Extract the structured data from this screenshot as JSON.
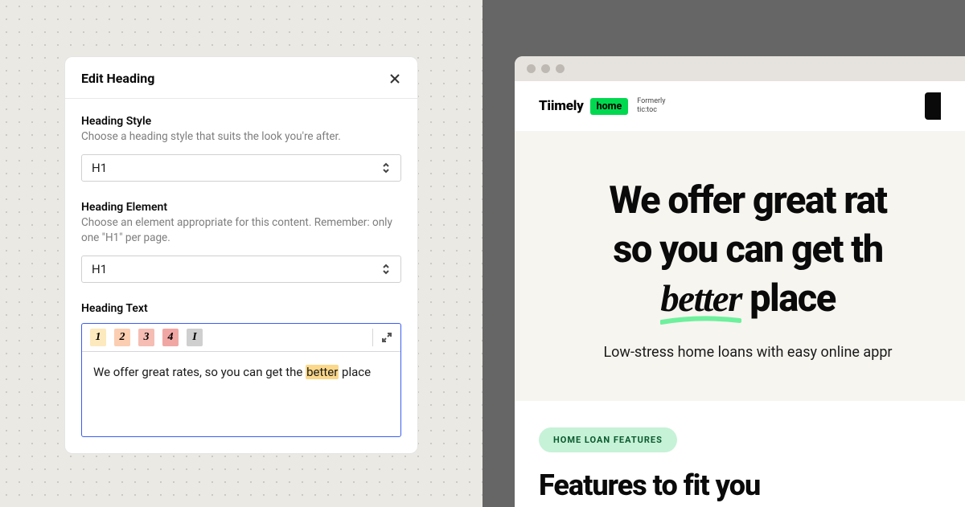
{
  "editor": {
    "title": "Edit Heading",
    "style": {
      "label": "Heading Style",
      "hint": "Choose a heading style that suits the look you're after.",
      "value": "H1"
    },
    "element": {
      "label": "Heading Element",
      "hint": "Choose an element appropriate for this content. Remember: only one \"H1\" per page.",
      "value": "H1"
    },
    "text": {
      "label": "Heading Text",
      "toolbar": {
        "b1": "1",
        "b2": "2",
        "b3": "3",
        "b4": "4",
        "bi": "I"
      },
      "content_pre": "We offer great rates, so you can get the ",
      "content_highlight": "better",
      "content_post": " place"
    }
  },
  "preview": {
    "logo_text": "Tiimely",
    "logo_badge": "home",
    "formerly_label": "Formerly",
    "formerly_value": "tic:toc",
    "hero_line1": "We offer great rat",
    "hero_line2": "so you can get th",
    "hero_word": "better",
    "hero_line3_post": " place",
    "subheading": "Low-stress home loans with easy online appr",
    "pill": "HOME LOAN FEATURES",
    "features_heading": "Features to fit you"
  }
}
